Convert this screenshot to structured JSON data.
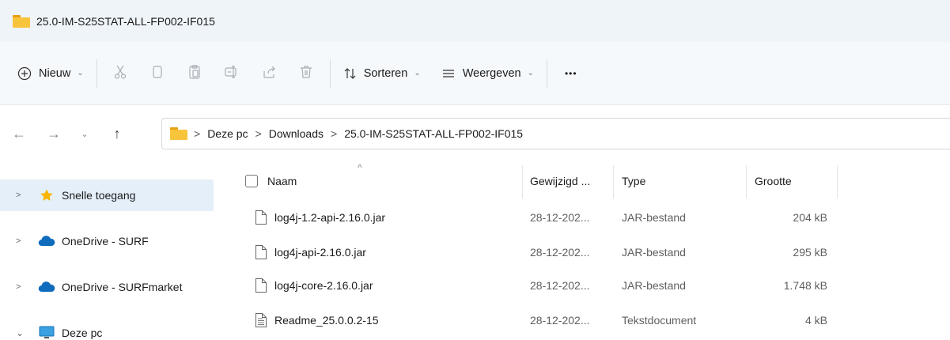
{
  "window": {
    "title": "25.0-IM-S25STAT-ALL-FP002-IF015"
  },
  "toolbar": {
    "new_label": "Nieuw",
    "sort_label": "Sorteren",
    "view_label": "Weergeven",
    "more_label": "•••",
    "icons": [
      "plus-circle-icon",
      "cut-icon",
      "copy-icon",
      "paste-icon",
      "rename-icon",
      "share-icon",
      "delete-icon",
      "sort-icon",
      "view-icon",
      "more-icon"
    ]
  },
  "address": {
    "breadcrumbs": [
      "Deze pc",
      "Downloads",
      "25.0-IM-S25STAT-ALL-FP002-IF015"
    ],
    "separator": ">"
  },
  "sidebar": {
    "items": [
      {
        "label": "Snelle toegang",
        "icon": "star-icon",
        "expanded": false,
        "selected": true
      },
      {
        "label": "OneDrive - SURF",
        "icon": "cloud-icon",
        "expanded": false,
        "selected": false
      },
      {
        "label": "OneDrive - SURFmarket",
        "icon": "cloud-icon",
        "expanded": false,
        "selected": false
      },
      {
        "label": "Deze pc",
        "icon": "monitor-icon",
        "expanded": true,
        "selected": false
      }
    ]
  },
  "file_list": {
    "columns": {
      "name": "Naam",
      "modified": "Gewijzigd ...",
      "type": "Type",
      "size": "Grootte"
    },
    "sort_indicator": "^",
    "rows": [
      {
        "name": "log4j-1.2-api-2.16.0.jar",
        "modified": "28-12-202...",
        "type": "JAR-bestand",
        "size": "204 kB",
        "icon": "file-icon"
      },
      {
        "name": "log4j-api-2.16.0.jar",
        "modified": "28-12-202...",
        "type": "JAR-bestand",
        "size": "295 kB",
        "icon": "file-icon"
      },
      {
        "name": "log4j-core-2.16.0.jar",
        "modified": "28-12-202...",
        "type": "JAR-bestand",
        "size": "1.748 kB",
        "icon": "file-icon"
      },
      {
        "name": "Readme_25.0.0.2-15",
        "modified": "28-12-202...",
        "type": "Tekstdocument",
        "size": "4 kB",
        "icon": "text-file-icon"
      }
    ]
  },
  "colors": {
    "titlebar_bg": "#eff4f9",
    "selected_bg": "#e5effa",
    "folder": "#f8c43c",
    "onedrive": "#0f6cbd",
    "star": "#f9b500"
  }
}
